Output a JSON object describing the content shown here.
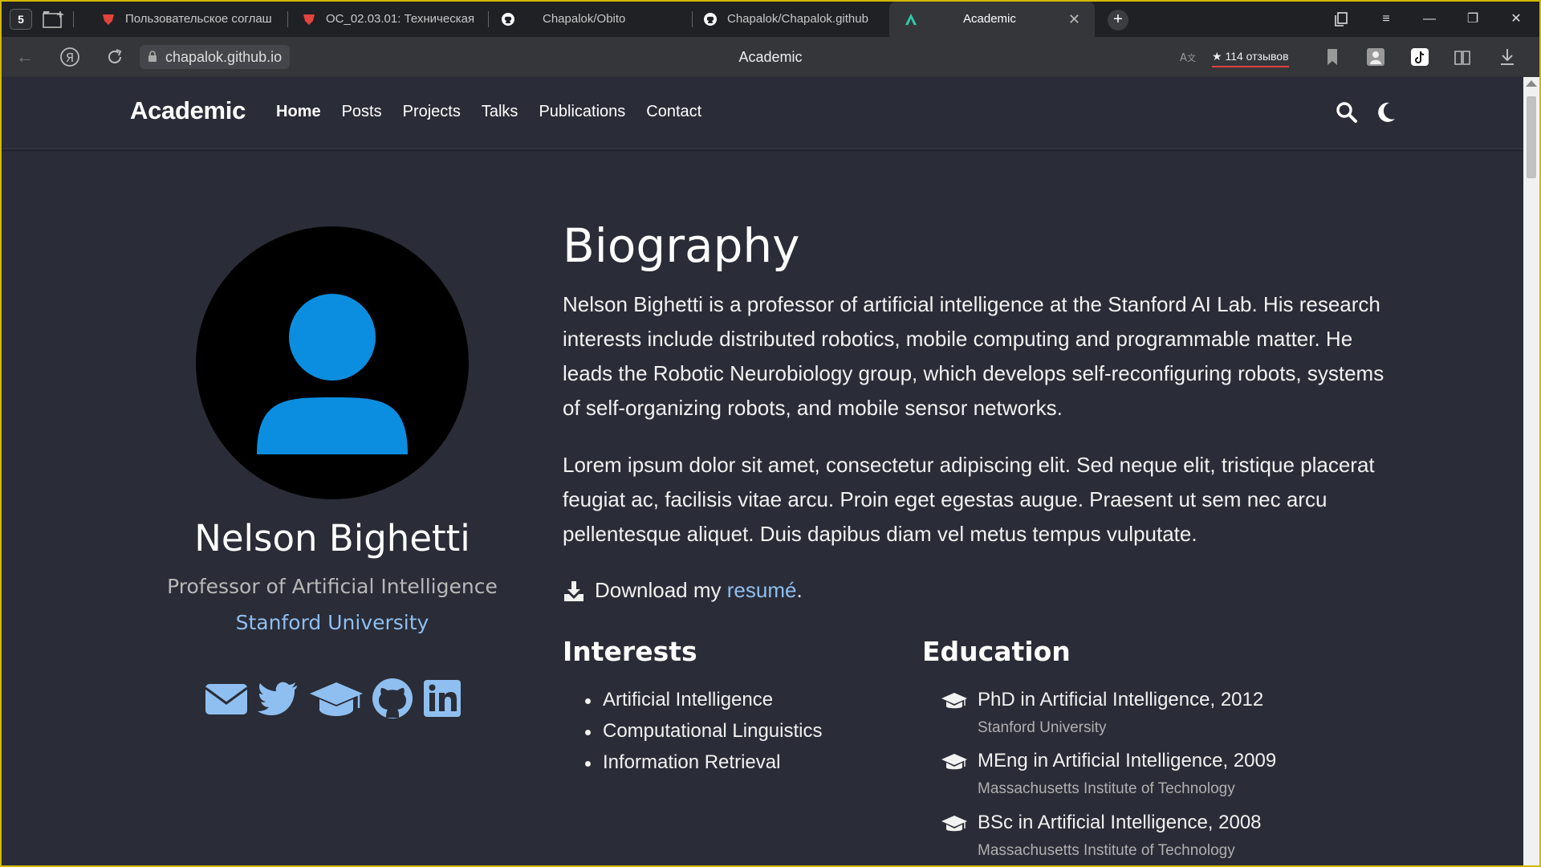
{
  "browser": {
    "tab_count": "5",
    "tabs": [
      {
        "label": "Пользовательское соглаш"
      },
      {
        "label": "ОС_02.03.01: Техническая"
      },
      {
        "label": "Chapalok/Obito"
      },
      {
        "label": "Chapalok/Chapalok.github"
      },
      {
        "label": "Academic"
      }
    ],
    "url": "chapalok.github.io",
    "page_title": "Academic",
    "reviews": "★ 114 отзывов",
    "colors": {
      "tab_accent": "#e0443e",
      "academic_icon": "#2fc8a8"
    }
  },
  "site": {
    "brand": "Academic",
    "nav": [
      "Home",
      "Posts",
      "Projects",
      "Talks",
      "Publications",
      "Contact"
    ],
    "accent": "#8fbff0"
  },
  "profile": {
    "name": "Nelson Bighetti",
    "role": "Professor of Artificial Intelligence",
    "organization": "Stanford University",
    "social_icons": [
      "envelope-icon",
      "twitter-icon",
      "graduation-cap-icon",
      "github-icon",
      "linkedin-icon"
    ],
    "avatar_color": "#0c8ee0"
  },
  "biography": {
    "title": "Biography",
    "paragraphs": [
      [
        "Nelson Bighetti is a professor of artificial intelligence at the Stanford AI Lab. His research",
        "interests include distributed robotics, mobile computing and programmable matter. He",
        "leads the Robotic Neurobiology group, which develops self-reconfiguring robots, systems",
        "of self-organizing robots, and mobile sensor networks."
      ],
      [
        "Lorem ipsum dolor sit amet, consectetur adipiscing elit. Sed neque elit, tristique placerat",
        "feugiat ac, facilisis vitae arcu. Proin eget egestas augue. Praesent ut sem nec arcu",
        "pellentesque aliquet. Duis dapibus diam vel metus tempus vulputate."
      ]
    ],
    "download_prefix": "Download my ",
    "download_link": "resumé",
    "download_suffix": "."
  },
  "interests": {
    "title": "Interests",
    "items": [
      "Artificial Intelligence",
      "Computational Linguistics",
      "Information Retrieval"
    ]
  },
  "education": {
    "title": "Education",
    "items": [
      {
        "course": "PhD in Artificial Intelligence, 2012",
        "institution": "Stanford University"
      },
      {
        "course": "MEng in Artificial Intelligence, 2009",
        "institution": "Massachusetts Institute of Technology"
      },
      {
        "course": "BSc in Artificial Intelligence, 2008",
        "institution": "Massachusetts Institute of Technology"
      }
    ]
  }
}
